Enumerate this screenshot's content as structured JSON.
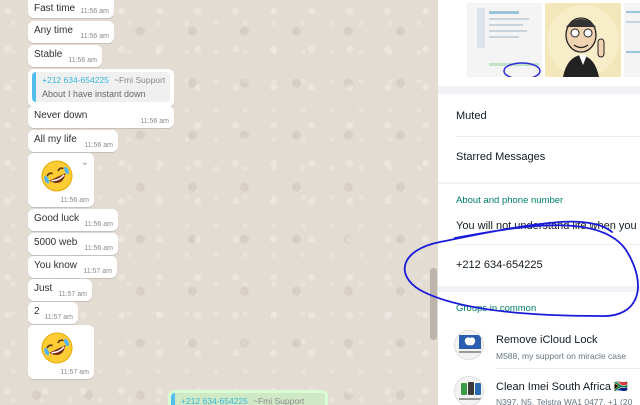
{
  "chat": {
    "messages": [
      {
        "text": "Fast time",
        "time": "11:56 am"
      },
      {
        "text": "Any time",
        "time": "11:56 am"
      },
      {
        "text": "Stable",
        "time": "11:56 am"
      },
      {
        "quote_number": "+212 634-654225",
        "quote_name": "~Fmi Support",
        "text": "About I have instant down"
      },
      {
        "text": "Never down",
        "time": "11:56 am"
      },
      {
        "text": "All my life",
        "time": "11:56 am"
      },
      {
        "emoji": "rolling-on-floor-laughing-emoji",
        "time": "11:56 am"
      },
      {
        "text": "Good luck",
        "time": "11:56 am"
      },
      {
        "text": "5000 web",
        "time": "11:56 am"
      },
      {
        "text": "You know",
        "time": "11:57 am"
      },
      {
        "text": "Just",
        "time": "11:57 am"
      },
      {
        "text": "2",
        "time": "11:57 am"
      },
      {
        "emoji": "rolling-on-floor-laughing-emoji",
        "time": "11:57 am"
      }
    ],
    "outgoing_quote": {
      "number": "+212 634-654225",
      "name": "~Fmi Support"
    }
  },
  "info": {
    "muted_label": "Muted",
    "starred_label": "Starred Messages",
    "about_section_label": "About and phone number",
    "about_text": "You will not understand life when you",
    "phone": "+212 634-654225",
    "groups_section_label": "Groups in common",
    "groups": [
      {
        "name": "Remove iCloud Lock",
        "subtitle": "M588, my support on miracle case"
      },
      {
        "name": "Clean Imei South Africa 🇿🇦",
        "subtitle": "N397, N5, Telstra WA1 0477, +1 (20"
      }
    ]
  },
  "colors": {
    "accent_green": "#008069",
    "annotation_blue": "#1a1adb",
    "quote_blue": "#53bdeb"
  }
}
